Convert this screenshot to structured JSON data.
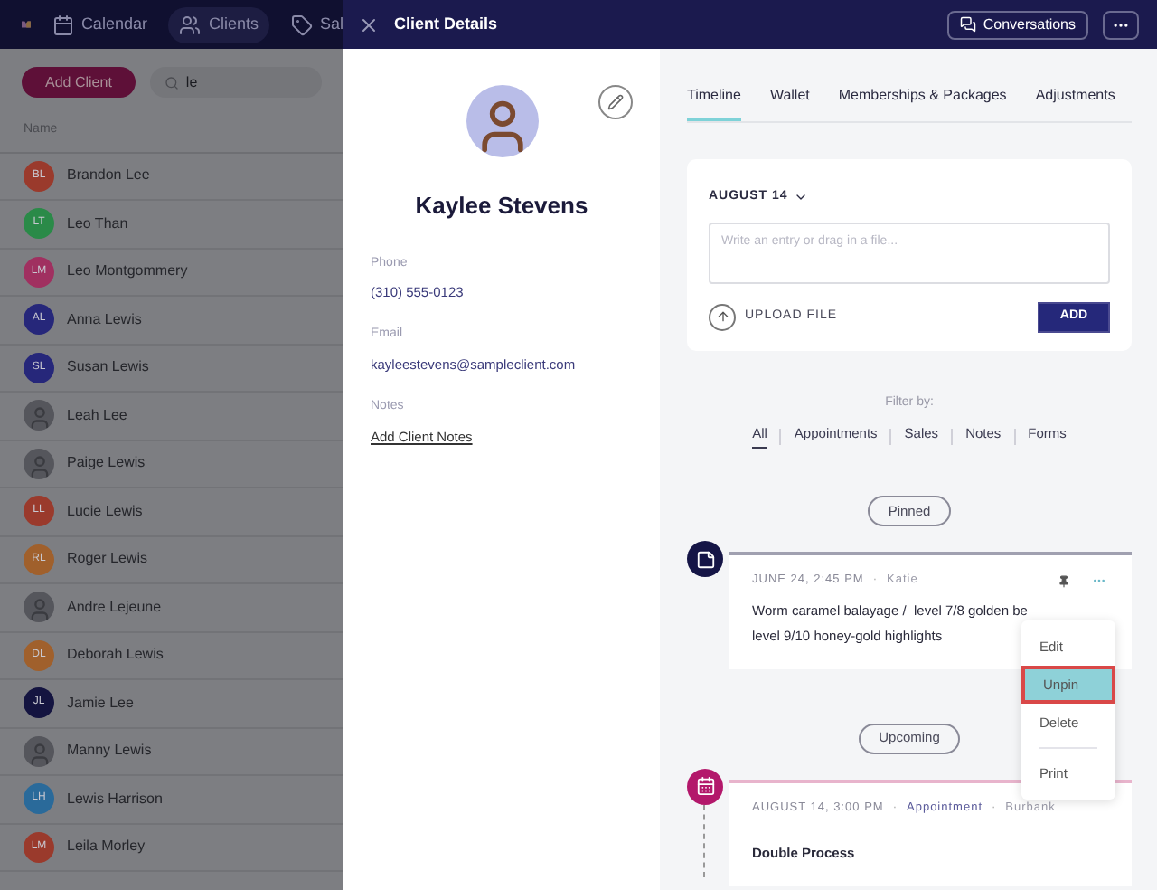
{
  "nav": {
    "items": [
      {
        "label": "Calendar",
        "kind": "calendar",
        "selected": false
      },
      {
        "label": "Clients",
        "kind": "clients",
        "selected": true
      },
      {
        "label": "Sal",
        "kind": "tag",
        "selected": false
      }
    ]
  },
  "client_list": {
    "add_button": "Add Client",
    "search": {
      "value": "le"
    },
    "column": "Name",
    "rows": [
      {
        "name": "Brandon Lee",
        "kind": "initials",
        "initials": "BL",
        "color": "#9a3a2c"
      },
      {
        "name": "Leo Than",
        "kind": "initials",
        "initials": "LT",
        "color": "#2a8a48"
      },
      {
        "name": "Leo Montgommery",
        "kind": "initials",
        "initials": "LM",
        "color": "#a03060"
      },
      {
        "name": "Anna Lewis",
        "kind": "initials",
        "initials": "AL",
        "color": "#26277a"
      },
      {
        "name": "Susan Lewis",
        "kind": "initials",
        "initials": "SL",
        "color": "#26277a"
      },
      {
        "name": "Leah Lee",
        "kind": "photo"
      },
      {
        "name": "Paige Lewis",
        "kind": "photo"
      },
      {
        "name": "Lucie Lewis",
        "kind": "initials",
        "initials": "LL",
        "color": "#9a3a2c"
      },
      {
        "name": "Roger Lewis",
        "kind": "initials",
        "initials": "RL",
        "color": "#a0602c"
      },
      {
        "name": "Andre Lejeune",
        "kind": "photo"
      },
      {
        "name": "Deborah Lewis",
        "kind": "initials",
        "initials": "DL",
        "color": "#a0602c"
      },
      {
        "name": "Jamie Lee",
        "kind": "initials",
        "initials": "JL",
        "color": "#141440"
      },
      {
        "name": "Manny Lewis",
        "kind": "photo"
      },
      {
        "name": "Lewis Harrison",
        "kind": "initials",
        "initials": "LH",
        "color": "#2a6a9a"
      },
      {
        "name": "Leila Morley",
        "kind": "initials",
        "initials": "LM",
        "color": "#9a3a2c"
      }
    ]
  },
  "panel": {
    "title": "Client Details",
    "conversations_button": "Conversations",
    "client": {
      "name": "Kaylee Stevens",
      "fields": [
        {
          "label": "Phone",
          "value": "(310) 555-0123",
          "kind": "text"
        },
        {
          "label": "Email",
          "value": "kayleestevens@sampleclient.com",
          "kind": "text"
        },
        {
          "label": "Notes",
          "value": "Add Client Notes",
          "kind": "link"
        }
      ]
    },
    "tabs": [
      {
        "label": "Timeline",
        "selected": true
      },
      {
        "label": "Wallet",
        "selected": false
      },
      {
        "label": "Memberships & Packages",
        "selected": false
      },
      {
        "label": "Adjustments",
        "selected": false
      }
    ],
    "composer": {
      "date": "AUGUST 14",
      "placeholder": "Write an entry or drag in a file...",
      "upload": "UPLOAD FILE",
      "add_button": "ADD"
    },
    "filter_label": "Filter by:",
    "filters": [
      {
        "label": "All",
        "selected": true
      },
      {
        "label": "Appointments",
        "selected": false
      },
      {
        "label": "Sales",
        "selected": false
      },
      {
        "label": "Notes",
        "selected": false
      },
      {
        "label": "Forms",
        "selected": false
      }
    ],
    "sections": [
      {
        "label": "Pinned",
        "entries": [
          {
            "kind": "note",
            "date": "JUNE 24, 2:45 PM",
            "meta": [
              {
                "sep": "·",
                "text": "Katie"
              }
            ],
            "pinned": true,
            "lines": [
              "Worm caramel balayage /  level 7/8 golden be",
              "level 9/10 honey-gold highlights"
            ]
          }
        ]
      },
      {
        "label": "Upcoming",
        "entries": [
          {
            "kind": "appointment",
            "date": "AUGUST 14, 3:00 PM",
            "meta": [
              {
                "sep": "·",
                "text": "Appointment"
              },
              {
                "sep": "·",
                "text": "Burbank"
              }
            ],
            "pinned": false,
            "title": "Double Process"
          }
        ]
      }
    ],
    "menu": [
      {
        "label": "Edit",
        "selected": false,
        "divider_before": false
      },
      {
        "label": "Unpin",
        "selected": true,
        "divider_before": false
      },
      {
        "label": "Delete",
        "selected": false,
        "divider_before": false
      },
      {
        "label": "Print",
        "selected": false,
        "divider_before": true
      }
    ]
  }
}
